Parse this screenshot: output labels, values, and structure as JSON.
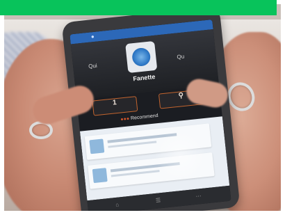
{
  "colors": {
    "top_bar": "#08c35b",
    "app_header": "#2c68b8",
    "accent_orange": "#c2642e"
  },
  "phone_screen": {
    "hero": {
      "title": "Fanette",
      "left_label": "Qui",
      "right_label": "Qu"
    },
    "actions": [
      {
        "value": "1",
        "label": ""
      },
      {
        "icon": "search-icon",
        "label": ""
      }
    ],
    "section_label": "Recommend",
    "list_items_count_visible": 2
  }
}
